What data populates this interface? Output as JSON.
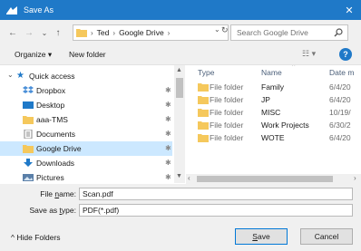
{
  "window": {
    "title": "Save As",
    "close": "✕"
  },
  "nav": {
    "back": "←",
    "forward": "→",
    "dropdown": "⌄",
    "up": "↑",
    "breadcrumb_sep": "›",
    "breadcrumbs": [
      "Ted",
      "Google Drive"
    ],
    "refresh": "↻",
    "search_placeholder": "Search Google Drive"
  },
  "toolbar": {
    "organize": "Organize ▾",
    "new_folder": "New folder",
    "view": "☷ ▾",
    "help": "?"
  },
  "sidebar": {
    "quick_access": "Quick access",
    "items": [
      {
        "label": "Dropbox",
        "icon": "dropbox-icon"
      },
      {
        "label": "Desktop",
        "icon": "desktop-icon"
      },
      {
        "label": "aaa-TMS",
        "icon": "folder-icon"
      },
      {
        "label": "Documents",
        "icon": "documents-icon"
      },
      {
        "label": "Google Drive",
        "icon": "folder-icon"
      },
      {
        "label": "Downloads",
        "icon": "downloads-icon"
      },
      {
        "label": "Pictures",
        "icon": "pictures-icon"
      }
    ],
    "pin": "✱"
  },
  "files": {
    "columns": {
      "type": "Type",
      "name": "Name",
      "date": "Date m"
    },
    "rows": [
      {
        "type": "File folder",
        "name": "Family",
        "date": "6/4/20"
      },
      {
        "type": "File folder",
        "name": "JP",
        "date": "6/4/20"
      },
      {
        "type": "File folder",
        "name": "MISC",
        "date": "10/19/"
      },
      {
        "type": "File folder",
        "name": "Work Projects",
        "date": "6/30/2"
      },
      {
        "type": "File folder",
        "name": "WOTE",
        "date": "6/4/20"
      }
    ]
  },
  "form": {
    "file_name_label_pre": "File ",
    "file_name_label_u": "n",
    "file_name_label_post": "ame:",
    "file_name_value": "Scan.pdf",
    "save_type_label_pre": "Save as ",
    "save_type_label_u": "t",
    "save_type_label_post": "ype:",
    "save_type_value": "PDF(*.pdf)"
  },
  "footer": {
    "hide_folders": "Hide Folders",
    "save_u": "S",
    "save_rest": "ave",
    "cancel": "Cancel"
  },
  "colors": {
    "accent": "#1f79c8",
    "folder": "#f5c85c",
    "selected": "#cce8ff"
  }
}
